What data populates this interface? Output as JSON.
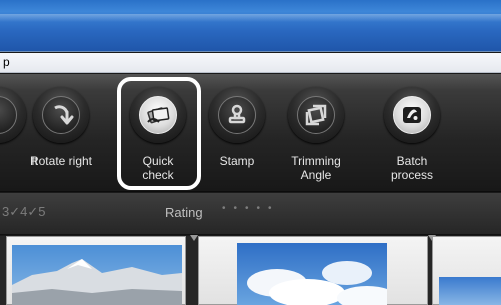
{
  "menubar": {
    "visible_item": "p"
  },
  "toolbar": {
    "items": [
      {
        "label": "ft",
        "icon": "rotate-left-icon"
      },
      {
        "label": "Rotate right",
        "icon": "rotate-right-icon"
      },
      {
        "label_line1": "Quick",
        "label_line2": "check",
        "icon": "quick-check-icon",
        "highlighted": true
      },
      {
        "label": "Stamp",
        "icon": "stamp-icon"
      },
      {
        "label_line1": "Trimming",
        "label_line2": "Angle",
        "icon": "trimming-angle-icon"
      },
      {
        "label_line1": "Batch",
        "label_line2": "process",
        "icon": "batch-process-icon"
      }
    ]
  },
  "rating_bar": {
    "star_digits": "3✓4✓5",
    "label": "Rating",
    "dots": "•••••"
  },
  "colors": {
    "title_blue": "#2a68c0",
    "toolbar_dark": "#252525",
    "highlight": "#ffffff",
    "sky_blue": "#3f7fd0"
  }
}
